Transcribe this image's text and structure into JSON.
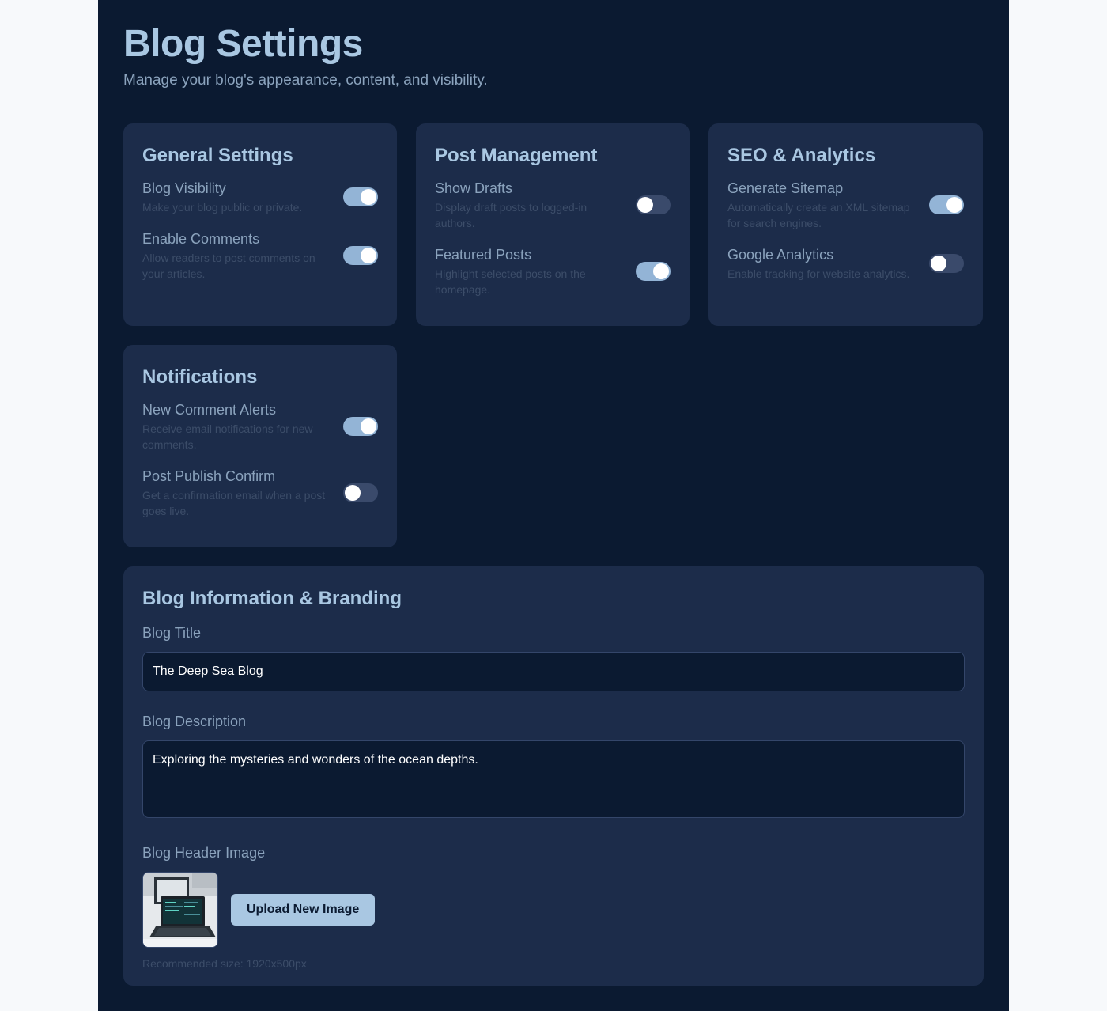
{
  "header": {
    "title": "Blog Settings",
    "subtitle": "Manage your blog's appearance, content, and visibility."
  },
  "cards": [
    {
      "title": "General Settings",
      "settings": [
        {
          "label": "Blog Visibility",
          "description": "Make your blog public or private.",
          "enabled": true
        },
        {
          "label": "Enable Comments",
          "description": "Allow readers to post comments on your articles.",
          "enabled": true
        }
      ]
    },
    {
      "title": "Post Management",
      "settings": [
        {
          "label": "Show Drafts",
          "description": "Display draft posts to logged-in authors.",
          "enabled": false
        },
        {
          "label": "Featured Posts",
          "description": "Highlight selected posts on the homepage.",
          "enabled": true
        }
      ]
    },
    {
      "title": "SEO & Analytics",
      "settings": [
        {
          "label": "Generate Sitemap",
          "description": "Automatically create an XML sitemap for search engines.",
          "enabled": true
        },
        {
          "label": "Google Analytics",
          "description": "Enable tracking for website analytics.",
          "enabled": false
        }
      ]
    },
    {
      "title": "Notifications",
      "settings": [
        {
          "label": "New Comment Alerts",
          "description": "Receive email notifications for new comments.",
          "enabled": true
        },
        {
          "label": "Post Publish Confirm",
          "description": "Get a confirmation email when a post goes live.",
          "enabled": false
        }
      ]
    }
  ],
  "branding": {
    "title": "Blog Information & Branding",
    "blog_title_label": "Blog Title",
    "blog_title_value": "The Deep Sea Blog",
    "blog_description_label": "Blog Description",
    "blog_description_value": "Exploring the mysteries and wonders of the ocean depths.",
    "header_image_label": "Blog Header Image",
    "upload_button": "Upload New Image",
    "recommended_size": "Recommended size: 1920x500px"
  },
  "colors": {
    "page_background": "#0b1a31",
    "card_background": "#1c2c4a",
    "accent": "#a9c7e2",
    "toggle_on": "#93b4d6",
    "toggle_off": "#3a4a6b"
  }
}
